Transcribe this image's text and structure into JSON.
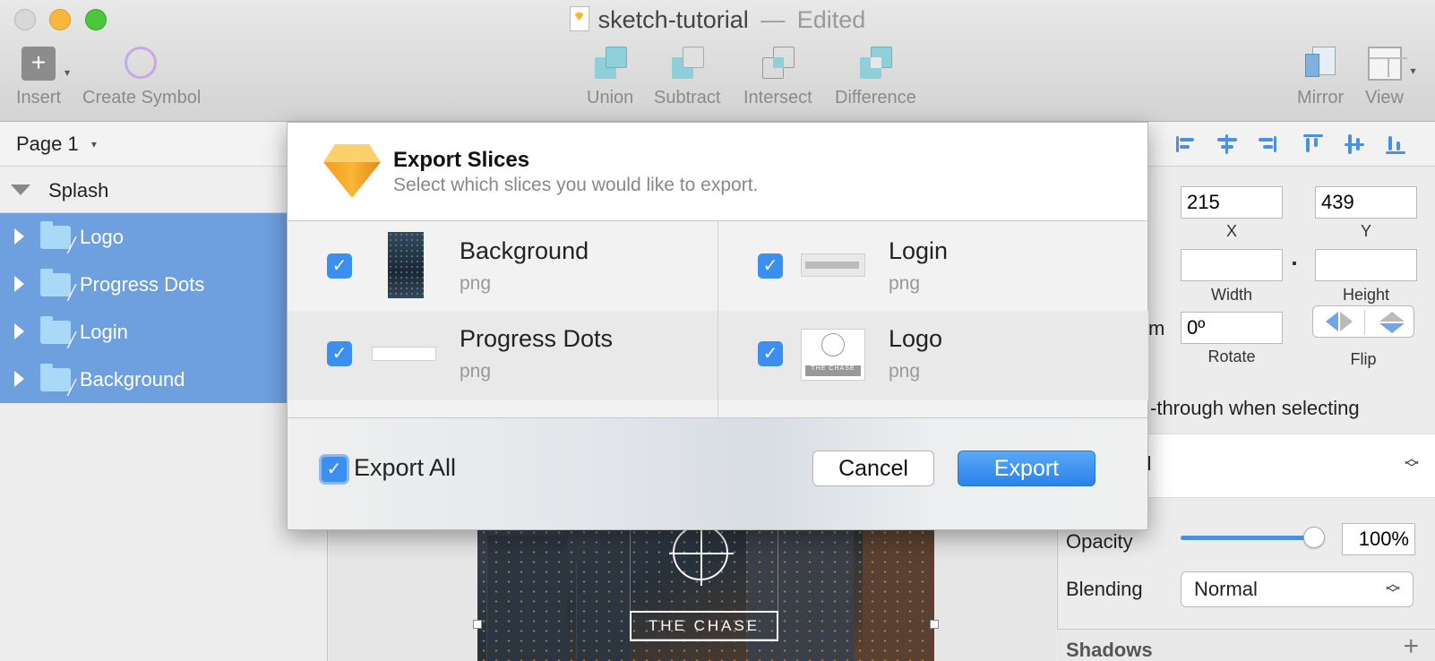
{
  "window": {
    "title": "sketch-tutorial",
    "separator": "—",
    "status": "Edited"
  },
  "toolbar": {
    "insert_label": "Insert",
    "create_symbol_label": "Create Symbol",
    "union_label": "Union",
    "subtract_label": "Subtract",
    "intersect_label": "Intersect",
    "difference_label": "Difference",
    "mirror_label": "Mirror",
    "view_label": "View"
  },
  "layers_panel": {
    "page_label": "Page 1",
    "artboard_label": "Splash",
    "layers": [
      {
        "label": "Logo"
      },
      {
        "label": "Progress Dots"
      },
      {
        "label": "Login"
      },
      {
        "label": "Background"
      }
    ]
  },
  "canvas": {
    "artboard_text": "THE CHASE"
  },
  "inspector": {
    "x_value": "215",
    "y_value": "439",
    "x_label": "X",
    "y_label": "Y",
    "width_value": "",
    "height_value": "",
    "width_label": "Width",
    "height_label": "Height",
    "transform_partial": "m",
    "rotate_value": "0º",
    "rotate_label": "Rotate",
    "flip_label": "Flip",
    "click_through_partial": "-through when selecting",
    "symbol_partial": "bol",
    "opacity_label": "Opacity",
    "opacity_value": "100%",
    "opacity_level": 1.0,
    "blending_label": "Blending",
    "blending_value": "Normal",
    "shadows_label": "Shadows",
    "add_shadow_symbol": "+"
  },
  "dialog": {
    "title": "Export Slices",
    "subtitle": "Select which slices you would like to export.",
    "slices": [
      {
        "name": "Background",
        "format": "png",
        "checked": true
      },
      {
        "name": "Login",
        "format": "png",
        "checked": true
      },
      {
        "name": "Progress Dots",
        "format": "png",
        "checked": true
      },
      {
        "name": "Logo",
        "format": "png",
        "checked": true
      }
    ],
    "logo_thumb_text": "THE CHASE",
    "export_all_label": "Export All",
    "cancel_label": "Cancel",
    "export_label": "Export"
  },
  "icons": {
    "checkmark": "✓",
    "caret": "▾",
    "plus": "+",
    "lock": "▪",
    "updown_up": "︿",
    "updown_down": "﹀"
  },
  "colors": {
    "accent": "#3b8ff0",
    "selection": "#6ea0e0"
  }
}
